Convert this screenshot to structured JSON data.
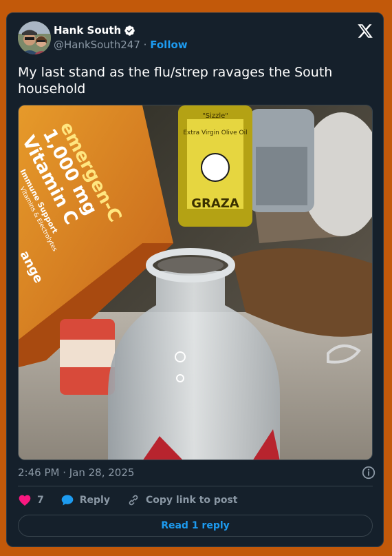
{
  "author": {
    "name": "Hank South",
    "handle": "@HankSouth247",
    "separator": "·",
    "follow_label": "Follow"
  },
  "tweet": {
    "text": "My last stand as the flu/strep ravages the South household",
    "timestamp": "2:46 PM · Jan 28, 2025"
  },
  "media": {
    "box_top": "emergen-C",
    "box_mid": "1,000 mg",
    "box_vit": "Vitamin C",
    "box_sub": "Immune Support",
    "box_sub2": "Vitamins & Electrolytes",
    "box_flavor": "ange",
    "bottle_top": "\"Sizzle\"",
    "bottle_mid": "Extra Virgin Olive Oil",
    "bottle_brand": "GRAZA"
  },
  "actions": {
    "like_count": "7",
    "reply_label": "Reply",
    "copy_label": "Copy link to post"
  },
  "read_reply_label": "Read 1 reply",
  "colors": {
    "background": "#c2590a",
    "card": "#15202b",
    "accent": "#1d9bf0",
    "like": "#f91880",
    "muted": "#8b98a5"
  }
}
